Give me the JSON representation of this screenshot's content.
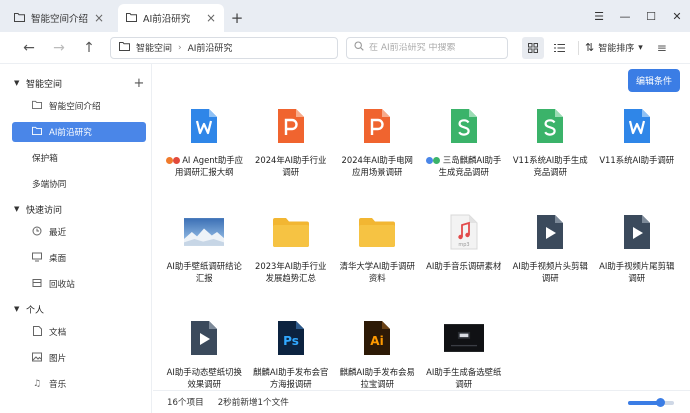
{
  "tabs": [
    {
      "label": "智能空间介绍",
      "active": false
    },
    {
      "label": "AI前沿研究",
      "active": true
    }
  ],
  "toolbar": {
    "breadcrumb": [
      "智能空间",
      "AI前沿研究"
    ],
    "search_placeholder": "在 AI前沿研究 中搜索",
    "sort_label": "智能排序"
  },
  "sidebar": {
    "section_space": "智能空间",
    "items_space": [
      {
        "label": "智能空间介绍",
        "icon": "folder-icon"
      },
      {
        "label": "AI前沿研究",
        "icon": "folder-icon",
        "active": true
      },
      {
        "label": "保护箱",
        "icon": ""
      },
      {
        "label": "多端协同",
        "icon": ""
      }
    ],
    "section_quick": "快速访问",
    "items_quick": [
      {
        "label": "最近",
        "icon": "clock-icon"
      },
      {
        "label": "桌面",
        "icon": "monitor-icon"
      },
      {
        "label": "回收站",
        "icon": "trash-icon"
      }
    ],
    "section_personal": "个人",
    "items_personal": [
      {
        "label": "文档",
        "icon": "document-icon"
      },
      {
        "label": "图片",
        "icon": "image-icon"
      },
      {
        "label": "音乐",
        "icon": "music-icon"
      }
    ]
  },
  "main": {
    "edit_button": "编辑条件",
    "files": [
      {
        "name": "AI Agent助手应用调研汇报大纲",
        "type": "word",
        "tags": [
          "#f07b2c",
          "#e24a3b"
        ]
      },
      {
        "name": "2024年AI助手行业调研",
        "type": "ppt"
      },
      {
        "name": "2024年AI助手电网应用场景调研",
        "type": "ppt"
      },
      {
        "name": "三岛麒麟AI助手生成竞品调研",
        "type": "sheet",
        "tags": [
          "#4a86e8",
          "#3bb36a"
        ]
      },
      {
        "name": "V11系统AI助手生成竞品调研",
        "type": "sheet"
      },
      {
        "name": "V11系统AI助手调研",
        "type": "word"
      },
      {
        "name": "AI助手壁纸调研结论汇报",
        "type": "image"
      },
      {
        "name": "2023年AI助手行业发展趋势汇总",
        "type": "folder"
      },
      {
        "name": "清华大学AI助手调研资料",
        "type": "folder"
      },
      {
        "name": "AI助手音乐调研素材",
        "type": "audio"
      },
      {
        "name": "AI助手视频片头剪辑调研",
        "type": "video"
      },
      {
        "name": "AI助手视频片尾剪辑调研",
        "type": "video"
      },
      {
        "name": "AI助手动态壁纸切换效果调研",
        "type": "video"
      },
      {
        "name": "麒麟AI助手发布会官方海报调研",
        "type": "ps"
      },
      {
        "name": "麒麟AI助手发布会易拉宝调研",
        "type": "ai"
      },
      {
        "name": "AI助手生成备选壁纸调研",
        "type": "screen"
      }
    ]
  },
  "status": {
    "count": "16个项目",
    "recent": "2秒前新增1个文件",
    "zoom_level": 0.7
  },
  "colors": {
    "accent": "#3b7de5",
    "word": "#2f86e8",
    "ppt": "#f0642f",
    "sheet": "#3bb36a",
    "folder": "#f6c343"
  }
}
